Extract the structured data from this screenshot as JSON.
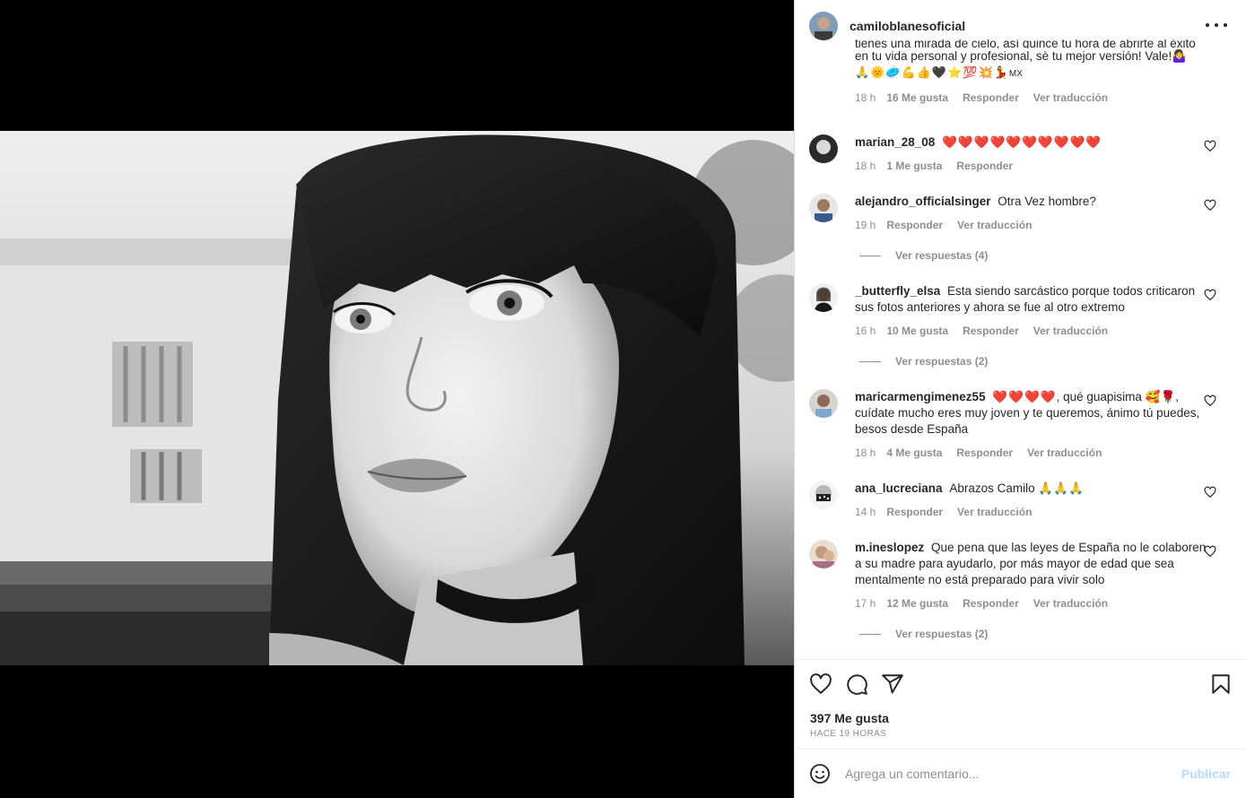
{
  "post": {
    "username": "camiloblanesoficial",
    "likes": "397 Me gusta",
    "time_ago": "HACE 19 HORAS"
  },
  "caption": {
    "line1": "tienes una mirada de cielo, así quince tu hora de abrirte al éxito",
    "line2": "en tu vida personal y profesional, sè tu mejor versión! Vale!🤷‍♀️",
    "emojis": "🙏🌞🥏💪👍🖤⭐💯💥💃",
    "emoji_suffix": "MX",
    "time": "18 h",
    "likes": "16 Me gusta",
    "reply": "Responder",
    "translate": "Ver traducción"
  },
  "comments": [
    {
      "user": "marian_28_08",
      "text": "",
      "hearts": "❤️❤️❤️❤️❤️❤️❤️❤️❤️❤️",
      "time": "18 h",
      "likes": "1 Me gusta",
      "reply": "Responder",
      "translate": ""
    },
    {
      "user": "alejandro_officialsinger",
      "text": "Otra Vez hombre?",
      "time": "19 h",
      "likes": "",
      "reply": "Responder",
      "translate": "Ver traducción",
      "replies": "Ver respuestas (4)"
    },
    {
      "user": "_butterfly_elsa",
      "text": "Esta siendo sarcástico porque todos criticaron sus fotos anteriores y ahora se fue al otro extremo",
      "time": "16 h",
      "likes": "10 Me gusta",
      "reply": "Responder",
      "translate": "Ver traducción",
      "replies": "Ver respuestas (2)"
    },
    {
      "user": "maricarmengimenez55",
      "hearts": "❤️❤️❤️❤️",
      "text": ", qué guapisima 🥰🌹, cuídate mucho eres muy joven y te queremos, ánimo tú puedes, besos desde España",
      "time": "18 h",
      "likes": "4 Me gusta",
      "reply": "Responder",
      "translate": "Ver traducción"
    },
    {
      "user": "ana_lucreciana",
      "text": "Abrazos Camilo 🙏🙏🙏",
      "time": "14 h",
      "likes": "",
      "reply": "Responder",
      "translate": "Ver traducción"
    },
    {
      "user": "m.ineslopez",
      "text": "Que pena que las leyes de España no le colaboren a su madre para ayudarlo, por más mayor de edad que sea mentalmente no está preparado para vivir solo",
      "time": "17 h",
      "likes": "12 Me gusta",
      "reply": "Responder",
      "translate": "Ver traducción",
      "replies": "Ver respuestas (2)"
    }
  ],
  "composer": {
    "placeholder": "Agrega un comentario...",
    "publish": "Publicar"
  },
  "colors": {
    "text": "#262626",
    "secondary": "#8e8e8e",
    "publish_disabled": "#b3dbff",
    "heart_red": "#e0102c"
  },
  "icons": [
    "heart-icon",
    "comment-icon",
    "share-icon",
    "bookmark-icon",
    "emoji-icon",
    "more-icon"
  ]
}
